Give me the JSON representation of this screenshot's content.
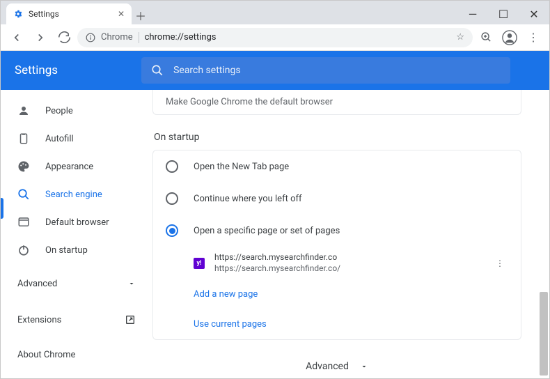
{
  "window": {
    "tab_title": "Settings"
  },
  "toolbar": {
    "chrome_label": "Chrome",
    "url": "chrome://settings"
  },
  "header": {
    "title": "Settings",
    "search_placeholder": "Search settings"
  },
  "sidebar": {
    "items": [
      {
        "label": "People"
      },
      {
        "label": "Autofill"
      },
      {
        "label": "Appearance"
      },
      {
        "label": "Search engine"
      },
      {
        "label": "Default browser"
      },
      {
        "label": "On startup"
      }
    ],
    "advanced": "Advanced",
    "extensions": "Extensions",
    "about": "About Chrome"
  },
  "main": {
    "default_browser_strip": "Make Google Chrome the default browser",
    "section_title": "On startup",
    "radio1": "Open the New Tab page",
    "radio2": "Continue where you left off",
    "radio3": "Open a specific page or set of pages",
    "page": {
      "title": "https://search.mysearchfinder.co",
      "url": "https://search.mysearchfinder.co/",
      "favicon_letter": "y!"
    },
    "add_page": "Add a new page",
    "use_current": "Use current pages",
    "bottom_advanced": "Advanced"
  }
}
